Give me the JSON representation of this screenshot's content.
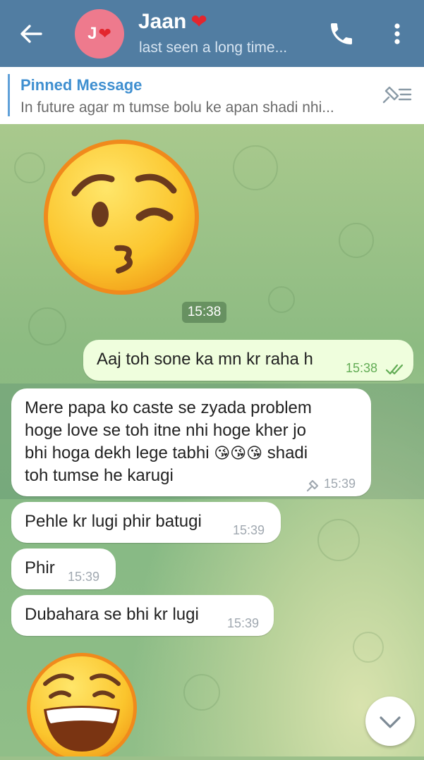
{
  "header": {
    "avatar_initial": "J",
    "avatar_heart": "❤",
    "contact_name": "Jaan",
    "name_heart": "❤",
    "status": "last seen a long time...",
    "icons": [
      "back-arrow-icon",
      "phone-icon",
      "more-vert-icon"
    ]
  },
  "pinned": {
    "title": "Pinned Message",
    "text": "In future agar m tumse bolu ke apan shadi nhi..."
  },
  "messages": [
    {
      "type": "sticker",
      "emoji": "kissing-face-wink",
      "time": "15:38"
    },
    {
      "type": "outgoing",
      "text": "Aaj toh sone ka mn kr raha h",
      "time": "15:38",
      "status": "read-double-check"
    },
    {
      "type": "incoming",
      "lines": [
        "Mere papa ko caste se zyada problem",
        "hoge love se toh itne nhi hoge kher jo",
        "bhi hoga dekh lege tabhi",
        "toh tumse he karugi"
      ],
      "line3_emojis": "😘😘😘",
      "line3_tail": " shadi",
      "time": "15:39",
      "pinned": true
    },
    {
      "type": "incoming",
      "text": "Pehle kr lugi phir batugi",
      "time": "15:39"
    },
    {
      "type": "incoming",
      "text": "Phir",
      "time": "15:39"
    },
    {
      "type": "incoming",
      "text": "Dubahara se bhi kr lugi",
      "time": "15:39"
    },
    {
      "type": "sticker",
      "emoji": "laughing-face"
    }
  ],
  "colors": {
    "header": "#517da2",
    "outgoing_bubble": "#effedd",
    "incoming_bubble": "#ffffff",
    "accent_blue": "#3f8fd0",
    "check_green": "#62ac55"
  }
}
